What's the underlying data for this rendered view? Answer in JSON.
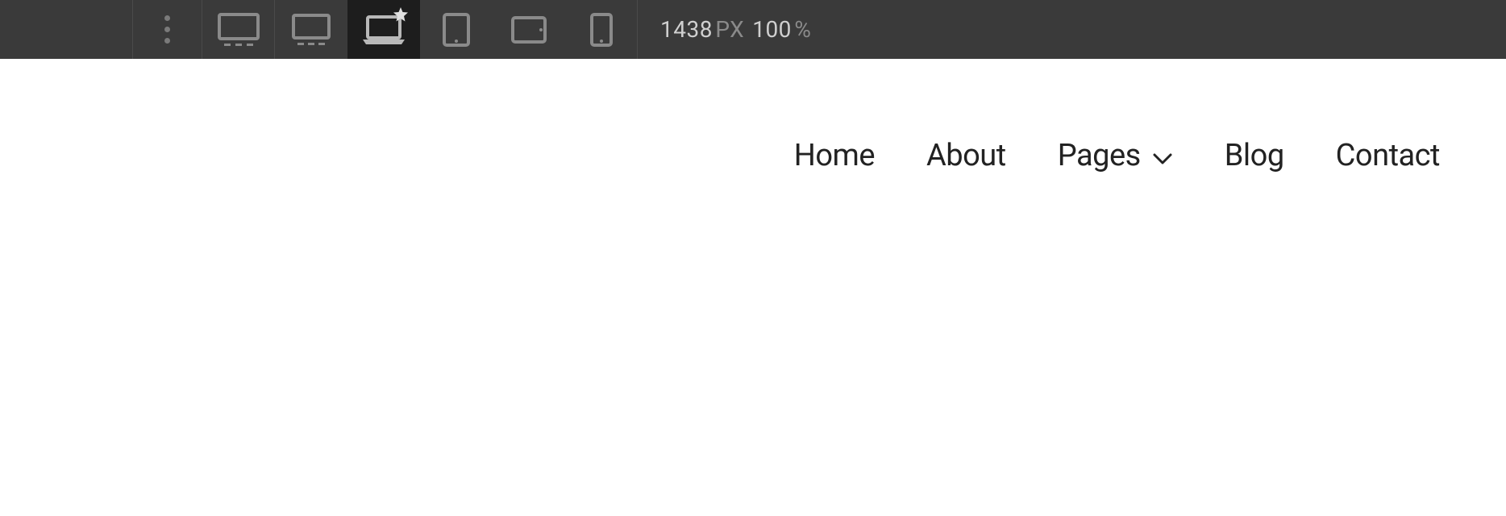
{
  "toolbar": {
    "width_value": "1438",
    "width_unit": "PX",
    "zoom_value": "100",
    "zoom_unit": "%",
    "devices": [
      {
        "id": "desktop-large",
        "active": false,
        "has_star": false
      },
      {
        "id": "desktop",
        "active": false,
        "has_star": false
      },
      {
        "id": "laptop",
        "active": true,
        "has_star": true
      },
      {
        "id": "tablet-portrait",
        "active": false,
        "has_star": false
      },
      {
        "id": "tablet-landscape",
        "active": false,
        "has_star": false
      },
      {
        "id": "mobile-portrait",
        "active": false,
        "has_star": false
      }
    ]
  },
  "nav": {
    "items": [
      {
        "label": "Home",
        "has_dropdown": false
      },
      {
        "label": "About",
        "has_dropdown": false
      },
      {
        "label": "Pages",
        "has_dropdown": true
      },
      {
        "label": "Blog",
        "has_dropdown": false
      },
      {
        "label": "Contact",
        "has_dropdown": false
      }
    ]
  }
}
